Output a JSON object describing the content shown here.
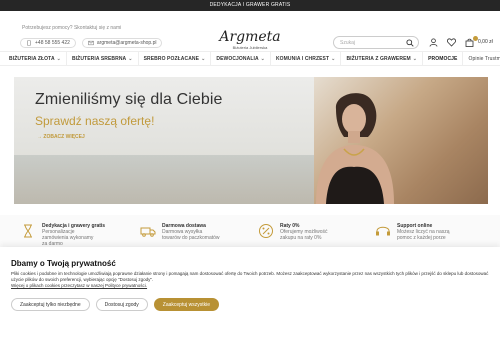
{
  "topbar": {
    "text": "DEDYKACJA I GRAWER GRATIS"
  },
  "header": {
    "contact_hint": "Potrzebujesz pomocy? Skontaktuj się z nami",
    "phone": "+48 58 555 422",
    "email": "argmeta@argmeta-shop.pl",
    "logo_name": "Argmeta",
    "logo_sub": "Biżuteria Jubilerska",
    "search_placeholder": "Szukaj",
    "cart_amount": "0,00 zł"
  },
  "nav": {
    "items": [
      {
        "label": "BIŻUTERIA ZŁOTA",
        "chevron": true
      },
      {
        "label": "BIŻUTERIA SREBRNA",
        "chevron": true
      },
      {
        "label": "SREBRO POZŁACANE",
        "chevron": true
      },
      {
        "label": "DEWOCJONALIA",
        "chevron": true
      },
      {
        "label": "KOMUNIA I CHRZEST",
        "chevron": true
      },
      {
        "label": "BIŻUTERIA Z GRAWEREM",
        "chevron": true
      },
      {
        "label": "PROMOCJE",
        "chevron": false
      }
    ],
    "trust": "Opinie Trustmate"
  },
  "hero": {
    "title": "Zmieniliśmy się dla Ciebie",
    "subtitle": "Sprawdź naszą ofertę!",
    "link": "→ ZOBACZ WIĘCEJ"
  },
  "features": [
    {
      "title": "Dedykacja i grawery gratis",
      "desc": "Personalizacje zamówienia wykonamy za darmo",
      "icon": "hourglass-icon"
    },
    {
      "title": "Darmowa dostawa",
      "desc": "Darmowa wysyłka towarów do paczkomatów",
      "icon": "truck-icon"
    },
    {
      "title": "Raty 0%",
      "desc": "Oferujemy możliwość zakupu na raty 0%",
      "icon": "percent-icon"
    },
    {
      "title": "Support online",
      "desc": "Możesz liczyć na naszą pomoc z każdej porze",
      "icon": "headset-icon"
    }
  ],
  "cookie": {
    "title": "Dbamy o Twoją prywatność",
    "text": "Pliki cookies i podobne im technologie umożliwiają poprawne działanie strony i pomagają nam dostosować ofertę do Twoich potrzeb. Możesz zaakceptować wykorzystanie przez nas wszystkich tych plików i przejść do sklepu lub dostosować użycie plików do swoich preferencji, wybierając opcję \"Dostosuj zgody\".",
    "link": "Więcej o plikach cookies przeczytasz w naszej Polityce prywatności.",
    "btn_necessary": "Zaakceptuj tylko niezbędne",
    "btn_customize": "Dostosuj zgody",
    "btn_all": "Zaakceptuj wszystkie"
  },
  "colors": {
    "accent": "#b89134",
    "topbar": "#262626"
  }
}
